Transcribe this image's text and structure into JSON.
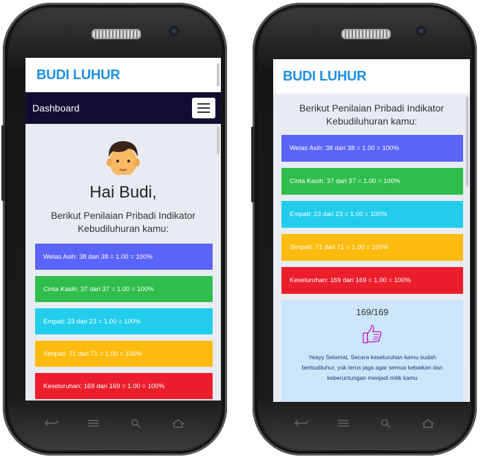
{
  "phones": {
    "left": {
      "brand": "BUDI LUHUR",
      "nav_title": "Dashboard",
      "greeting": "Hai Budi,",
      "heading": "Berikut Penilaian Pribadi Indikator Kebudiluhuran kamu:",
      "bars": [
        {
          "text": "Welas Asih: 38 dari 38 = 1.00 = 100%",
          "color": "#5b64f8"
        },
        {
          "text": "Cinta Kasih: 37 dari 37 = 1.00 = 100%",
          "color": "#2fbe4c"
        },
        {
          "text": "Empati: 23 dari 23 = 1.00 = 100%",
          "color": "#22cdec"
        },
        {
          "text": "Simpati: 71 dari 71 = 1.00 = 100%",
          "color": "#fdbb0f"
        },
        {
          "text": "Keseluruhan: 169 dari 169 = 1.00 = 100%",
          "color": "#ec1e2b"
        }
      ]
    },
    "right": {
      "brand": "BUDI LUHUR",
      "heading": "Berikut Penilaian Pribadi Indikator Kebudiluhuran kamu:",
      "bars": [
        {
          "text": "Welas Asih: 38 dari 38 = 1.00 = 100%",
          "color": "#5b64f8"
        },
        {
          "text": "Cinta Kasih: 37 dari 37 = 1.00 = 100%",
          "color": "#2fbe4c"
        },
        {
          "text": "Empati: 23 dari 23 = 1.00 = 100%",
          "color": "#22cdec"
        },
        {
          "text": "Simpati: 71 dari 71 = 1.00 = 100%",
          "color": "#fdbb0f"
        },
        {
          "text": "Keseluruhan: 169 dari 169 = 1.00 = 100%",
          "color": "#ec1e2b"
        }
      ],
      "score": "169/169",
      "message": "Yeayy Selamat, Secara keseluruhan kamu sudah berbudiluhur, yuk terus jaga agar semua kebaikan dan keberuntungan menjadi milik kamu"
    }
  },
  "icons": {
    "avatar": "boy-avatar-icon",
    "thumbs": "thumbs-up-icon",
    "menu": "hamburger-icon",
    "keys": [
      "back-icon",
      "menu-icon",
      "search-icon",
      "home-icon"
    ]
  },
  "colors": {
    "brand": "#1f8fe5",
    "navbar": "#120e33",
    "card": "#cce5fb"
  }
}
